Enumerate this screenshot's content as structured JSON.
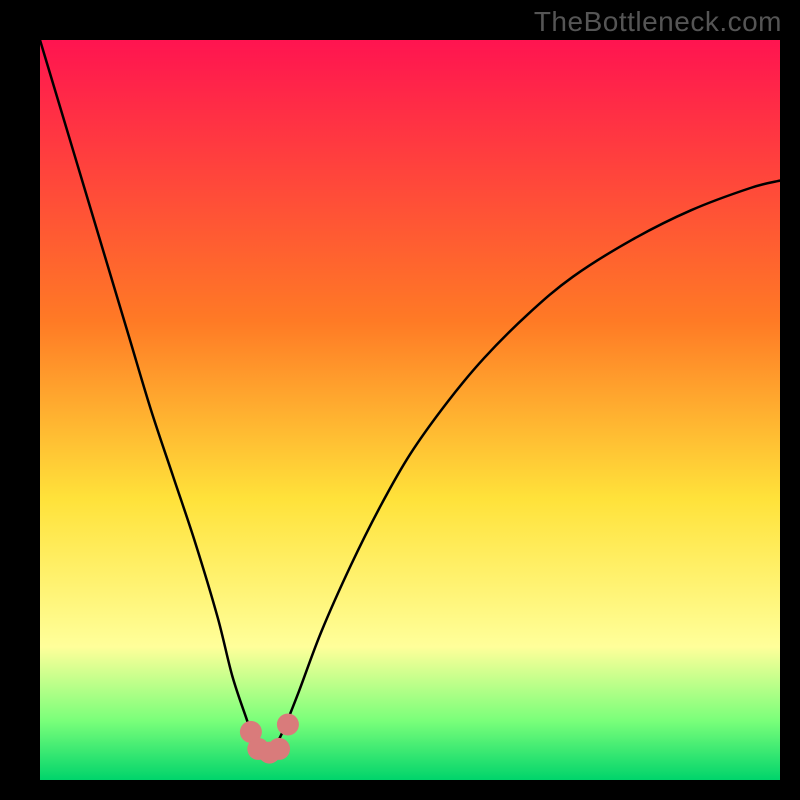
{
  "watermark": "TheBottleneck.com",
  "colors": {
    "red": "#ff1450",
    "orange": "#ff7a25",
    "yellow": "#ffe23a",
    "paleyellow": "#ffff9a",
    "lightgreen": "#7aff7a",
    "green": "#00d46b",
    "black": "#000000",
    "marker": "#d97b7b"
  },
  "chart_data": {
    "type": "line",
    "title": "",
    "xlabel": "",
    "ylabel": "",
    "xlim": [
      0,
      100
    ],
    "ylim": [
      0,
      100
    ],
    "grid": false,
    "series": [
      {
        "name": "bottleneck-curve",
        "x": [
          0,
          3,
          6,
          9,
          12,
          15,
          18,
          21,
          24,
          26,
          28,
          29,
          30,
          31,
          32,
          33,
          35,
          38,
          42,
          46,
          50,
          55,
          60,
          66,
          72,
          80,
          88,
          96,
          100
        ],
        "y": [
          100,
          90,
          80,
          70,
          60,
          50,
          41,
          32,
          22,
          14,
          8,
          5,
          4,
          4,
          5,
          7,
          12,
          20,
          29,
          37,
          44,
          51,
          57,
          63,
          68,
          73,
          77,
          80,
          81
        ]
      }
    ],
    "markers": [
      {
        "name": "sweet-spot-left",
        "x": 28.5,
        "y": 6.5
      },
      {
        "name": "sweet-spot-right",
        "x": 33.5,
        "y": 7.5
      },
      {
        "name": "sweet-spot-well-a",
        "x": 29.5,
        "y": 4.2
      },
      {
        "name": "sweet-spot-well-b",
        "x": 31.0,
        "y": 3.7
      },
      {
        "name": "sweet-spot-well-c",
        "x": 32.3,
        "y": 4.2
      }
    ],
    "gradient_stops_pct": [
      {
        "pct": 0,
        "color_key": "red"
      },
      {
        "pct": 38,
        "color_key": "orange"
      },
      {
        "pct": 62,
        "color_key": "yellow"
      },
      {
        "pct": 82,
        "color_key": "paleyellow"
      },
      {
        "pct": 92,
        "color_key": "lightgreen"
      },
      {
        "pct": 100,
        "color_key": "green"
      }
    ]
  }
}
